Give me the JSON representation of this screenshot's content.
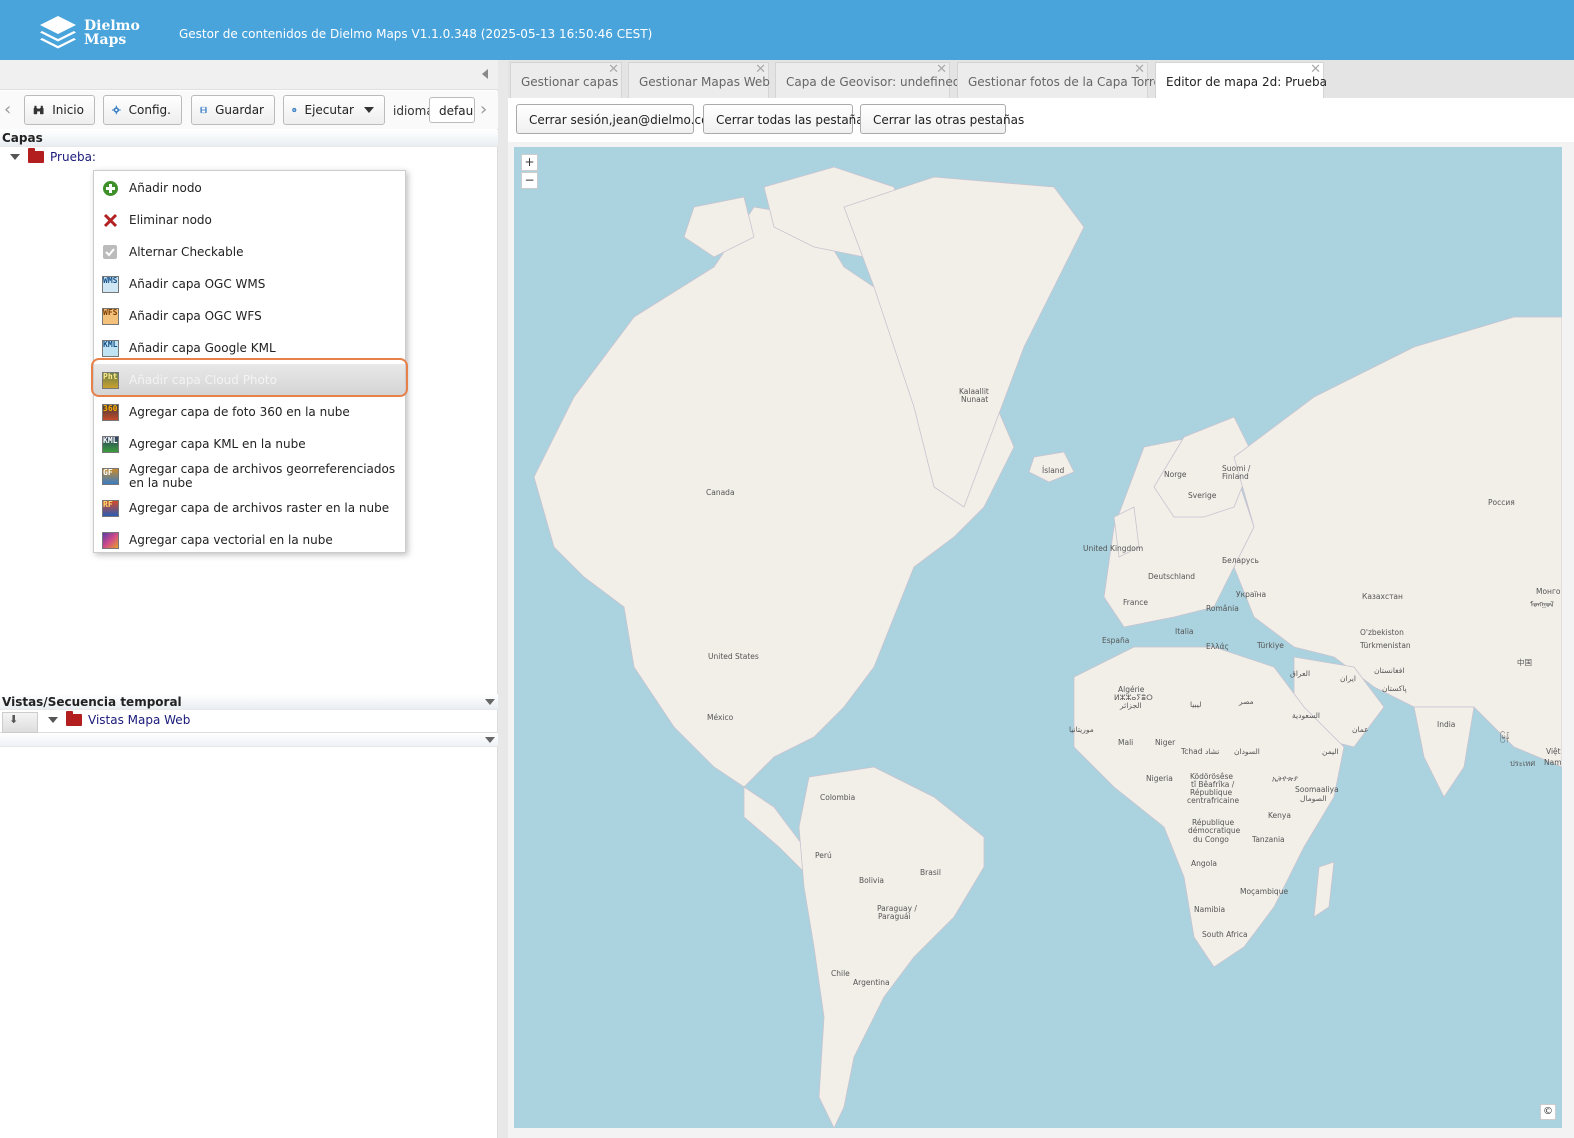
{
  "header": {
    "logo_line1": "Dielmo",
    "logo_line2": "Maps",
    "title": "Gestor de contenidos de Dielmo Maps V1.1.0.348 (2025-05-13 16:50:46 CEST)"
  },
  "toolbar": {
    "inicio": "Inicio",
    "config": "Config.",
    "guardar": "Guardar",
    "ejecutar": "Ejecutar",
    "idioma_label": "idioma:",
    "idioma_value": "default"
  },
  "capas": {
    "title": "Capas",
    "root_label": "Prueba:"
  },
  "context_menu": {
    "items": [
      {
        "label": "Añadir nodo",
        "icon": "add-green-icon"
      },
      {
        "label": "Eliminar nodo",
        "icon": "delete-red-x-icon"
      },
      {
        "label": "Alternar Checkable",
        "icon": "checkbox-icon"
      },
      {
        "label": "Añadir capa OGC WMS",
        "icon": "wms-layer-icon"
      },
      {
        "label": "Añadir capa OGC WFS",
        "icon": "wfs-layer-icon"
      },
      {
        "label": "Añadir capa Google KML",
        "icon": "kml-layer-icon"
      },
      {
        "label": "Añadir capa Cloud Photo",
        "icon": "cloud-photo-icon"
      },
      {
        "label": "Agregar capa de foto 360 en la nube",
        "icon": "photo-360-icon"
      },
      {
        "label": "Agregar capa KML en la nube",
        "icon": "cloud-kml-icon"
      },
      {
        "label": "Agregar capa de archivos georreferenciados en la nube",
        "icon": "georef-files-icon"
      },
      {
        "label": "Agregar capa de archivos raster en la nube",
        "icon": "raster-files-icon"
      },
      {
        "label": "Agregar capa vectorial en la nube",
        "icon": "vector-layer-icon"
      }
    ],
    "highlighted_index": 6,
    "icon_text": {
      "wms": "WMS",
      "wfs": "WFS",
      "kml": "KML",
      "pht": "Pht",
      "p360": "360",
      "ckml": "KML",
      "gf": "GF",
      "rf": "RF"
    }
  },
  "vistas": {
    "title": "Vistas/Secuencia temporal",
    "node_label": "Vistas Mapa Web"
  },
  "tabs": [
    {
      "label": "Gestionar capas",
      "close": "✕"
    },
    {
      "label": "Gestionar Mapas Web",
      "close": "✕"
    },
    {
      "label": "Capa de Geovisor: undefined",
      "close": "✕"
    },
    {
      "label": "Gestionar fotos de la Capa Torre",
      "close": "✕"
    },
    {
      "label": "Editor de mapa 2d: Prueba",
      "close": "✕"
    }
  ],
  "active_tab_index": 4,
  "actions": {
    "logout": "Cerrar sesión,jean@dielmo.com",
    "close_all": "Cerrar todas las pestañas",
    "close_others": "Cerrar las otras pestañas"
  },
  "map": {
    "zoom_in": "+",
    "zoom_out": "−",
    "attribution": "©",
    "labels": {
      "kalaallit1": "Kalaallit",
      "kalaallit2": "Nunaat",
      "canada": "Canada",
      "island": "Ísland",
      "norge": "Norge",
      "sverige": "Sverige",
      "suomi1": "Suomi /",
      "suomi2": "Finland",
      "russia": "Россия",
      "uk": "United Kingdom",
      "deutschland": "Deutschland",
      "belarus": "Беларусь",
      "ukraina": "Україна",
      "kazakhstan": "Казахстан",
      "mongolia1": "Монго",
      "mongolia2": "ᠮᠣᠩᠭᠣᠯ",
      "france": "France",
      "romania": "România",
      "espana": "España",
      "italia": "Italia",
      "ellas": "Ελλάς",
      "turkiye": "Türkiye",
      "uzbek": "O'zbekiston",
      "turkmen": "Türkmenistan",
      "china": "中国",
      "us": "United States",
      "algerie1": "Algérie",
      "algerie2": "ⵍⵣⵣⴰⵢⴻⵔ",
      "algerie3": "الجزائر",
      "libya": "ليبيا",
      "egypt": "مصر",
      "iraq": "العراق",
      "iran": "ایران",
      "afghan": "افغانستان",
      "pakistan": "پاکستان",
      "saudi": "السعودية",
      "india": "India",
      "mexico": "México",
      "mauritania": "موريتانيا",
      "mali": "Mali",
      "niger": "Niger",
      "tchad": "Tchad تشاد",
      "sudan": "السودان",
      "yemen": "اليمن",
      "oman": "عمان",
      "nigeria": "Nigeria",
      "ethiopia": "ኢትዮጵያ",
      "car1": "Ködörösêse",
      "car2": "tî Bêafrîka /",
      "car3": "République",
      "car4": "centrafricaine",
      "somalia1": "Soomaaliya",
      "somalia2": "الصومال",
      "kenya": "Kenya",
      "rdc1": "République",
      "rdc2": "démocratique",
      "rdc3": "du Congo",
      "tanzania": "Tanzania",
      "colombia": "Colombia",
      "peru": "Perú",
      "brasil": "Brasil",
      "bolivia": "Bolivia",
      "paraguay1": "Paraguay /",
      "paraguay2": "Paraguái",
      "angola": "Angola",
      "mocambique": "Moçambique",
      "namibia": "Namibia",
      "southafrica": "South Africa",
      "chile": "Chile",
      "argentina": "Argentina",
      "viet": "Việt",
      "vietnam2": "Nam",
      "myanmar": "မြန်",
      "thai": "ประเทศ"
    }
  }
}
